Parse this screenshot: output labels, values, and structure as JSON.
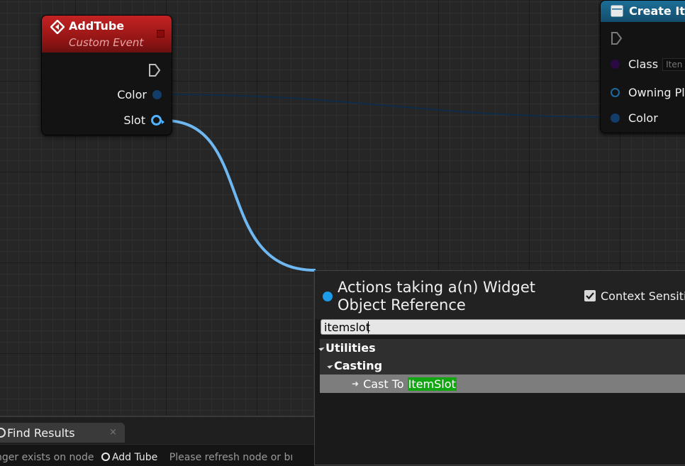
{
  "event_node": {
    "title": "AddTube",
    "subtitle": "Custom Event",
    "pins": {
      "color": "Color",
      "slot": "Slot"
    },
    "header_color": "#b11b1b"
  },
  "create_node": {
    "title": "Create Ite",
    "pins": {
      "class_label": "Class",
      "class_value": "Iten",
      "owning": "Owning Pl",
      "color": "Color"
    },
    "header_color": "#1a6990"
  },
  "find_results": {
    "tab_label": "Find Results",
    "close_glyph": "×",
    "message_prefix": "nger exists on node",
    "message_node": "Add Tube",
    "message_suffix": "Please refresh node or bı"
  },
  "action_menu": {
    "title": "Actions taking a(n) Widget Object Reference",
    "context_sensitive_label": "Context Sensitiv",
    "context_sensitive_checked": true,
    "search_value": "itemslot",
    "tree": {
      "category": "Utilities",
      "subcategory": "Casting",
      "item_prefix": "Cast To ",
      "item_match": "ItemSlot"
    },
    "accent_color": "#1c9be8",
    "highlight_color": "#12a712"
  },
  "wire_color": "#6fb7f1"
}
